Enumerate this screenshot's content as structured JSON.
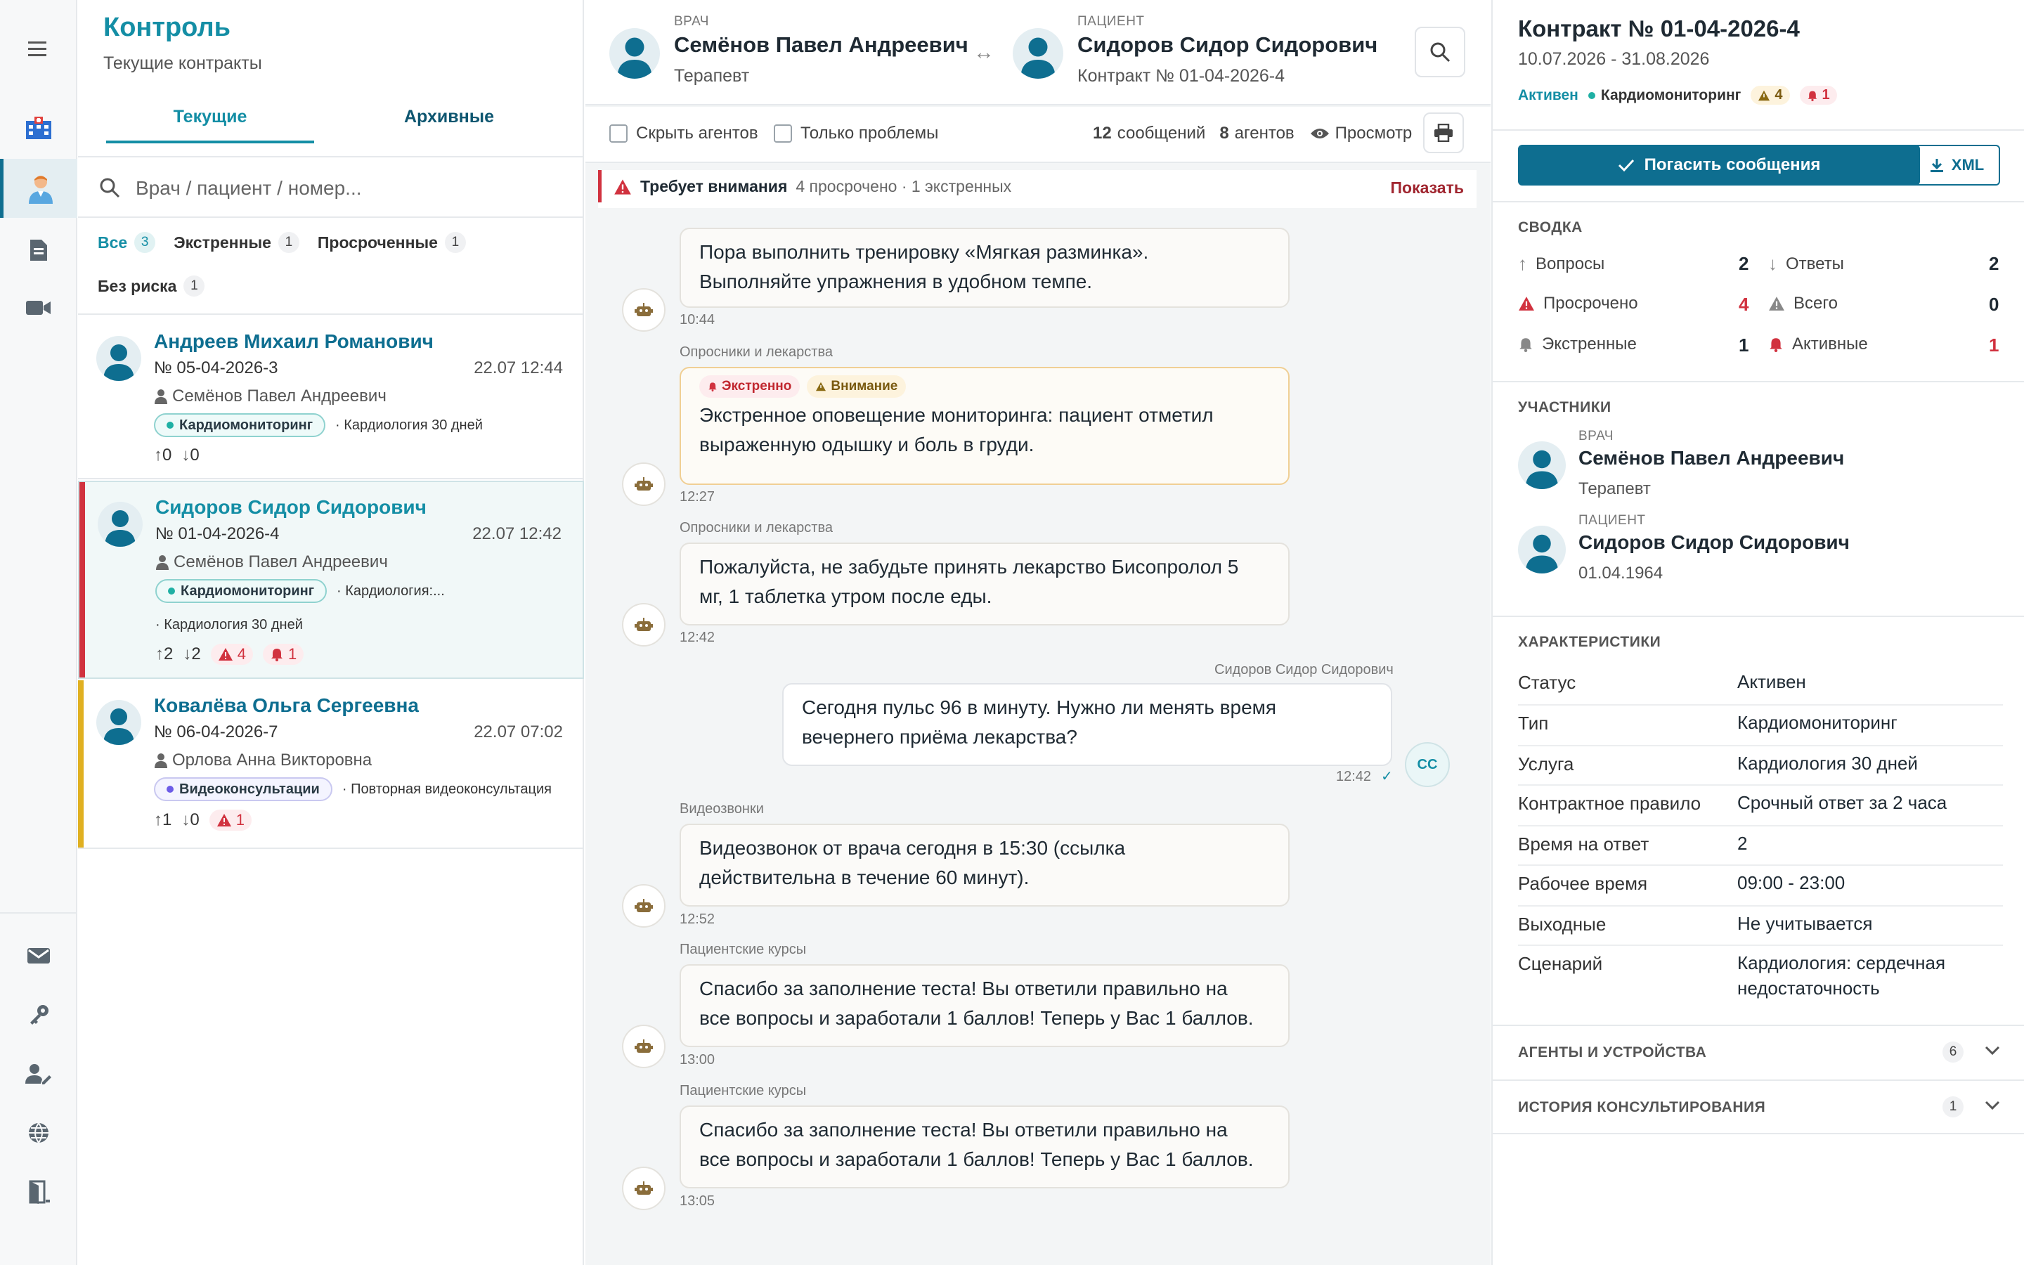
{
  "list": {
    "title": "Контроль",
    "subtitle": "Текущие контракты",
    "tabs": [
      "Текущие",
      "Архивные"
    ],
    "search_placeholder": "Врач / пациент / номер...",
    "filters": [
      {
        "label": "Все",
        "count": "3"
      },
      {
        "label": "Экстренные",
        "count": "1"
      },
      {
        "label": "Просроченные",
        "count": "1"
      },
      {
        "label": "Без риска",
        "count": "1"
      }
    ],
    "cards": [
      {
        "name": "Андреев Михаил Романович",
        "number": "№ 05-04-2026-3",
        "date": "22.07 12:44",
        "doctor": "Семёнов Павел Андреевич",
        "type": "Кардиомониторинг",
        "service": "Кардиология 30 дней",
        "up": "0",
        "down": "0"
      },
      {
        "name": "Сидоров Сидор Сидорович",
        "number": "№ 01-04-2026-4",
        "date": "22.07 12:42",
        "doctor": "Семёнов Павел Андреевич",
        "type": "Кардиомониторинг",
        "service": "Кардиология:...",
        "service2": "Кардиология 30 дней",
        "up": "2",
        "down": "2",
        "overdue": "4",
        "urgent": "1"
      },
      {
        "name": "Ковалёва Ольга Сергеевна",
        "number": "№ 06-04-2026-7",
        "date": "22.07 07:02",
        "doctor": "Орлова Анна Викторовна",
        "type": "Видеоконсультации",
        "service": "Повторная видеоконсультация",
        "up": "1",
        "down": "0",
        "overdue": "1"
      }
    ]
  },
  "chat": {
    "doctor_cap": "ВРАЧ",
    "doctor_name": "Семёнов Павел Андреевич",
    "doctor_role": "Терапевт",
    "patient_cap": "ПАЦИЕНТ",
    "patient_name": "Сидоров Сидор Сидорович",
    "patient_contract": "Контракт № 01-04-2026-4",
    "hide_agents": "Скрыть агентов",
    "only_problems": "Только проблемы",
    "messages_count": "12",
    "messages_label": "сообщений",
    "agents_count": "8",
    "agents_label": "агентов",
    "preview": "Просмотр",
    "alert_title": "Требует внимания",
    "alert_text": "4 просрочено · 1 экстренных",
    "alert_action": "Показать",
    "messages": [
      {
        "label": "",
        "text1": "Пора выполнить тренировку «Мягкая разминка».",
        "text2": "Выполняйте упражнения в удобном темпе.",
        "time": "10:44"
      },
      {
        "label": "Опросники и лекарства",
        "tag1": "Экстренно",
        "tag2": "Внимание",
        "text1": "Экстренное оповещение мониторинга: пациент отметил",
        "text2": "выраженную одышку и боль в груди.",
        "time": "12:27"
      },
      {
        "label": "Опросники и лекарства",
        "text1": "Пожалуйста, не забудьте принять лекарство Бисопролол 5",
        "text2": "мг, 1 таблетка утром после еды.",
        "time": "12:42"
      },
      {
        "label": "Сидоров Сидор Сидорович",
        "text1": "Сегодня пульс 96 в минуту. Нужно ли менять время",
        "text2": "вечернего приёма лекарства?",
        "time": "12:42",
        "initials": "СС"
      },
      {
        "label": "Видеозвонки",
        "text1": "Видеозвонок от врача сегодня в 15:30 (ссылка",
        "text2": "действительна в течение 60 минут).",
        "time": "12:52"
      },
      {
        "label": "Пациентские курсы",
        "text1": "Спасибо за заполнение теста! Вы ответили правильно на",
        "text2": "все вопросы и заработали 1 баллов! Теперь у Вас 1 баллов.",
        "time": "13:00"
      },
      {
        "label": "Пациентские курсы",
        "text1": "Спасибо за заполнение теста! Вы ответили правильно на",
        "text2": "все вопросы и заработали 1 баллов! Теперь у Вас 1 баллов.",
        "time": "13:05"
      }
    ]
  },
  "right": {
    "title": "Контракт № 01-04-2026-4",
    "period": "10.07.2026 - 31.08.2026",
    "status": "Активен",
    "type": "Кардиомониторинг",
    "badge_overdue": "4",
    "badge_urgent": "1",
    "repay_button": "Погасить сообщения",
    "xml_button": "XML",
    "summary_title": "СВОДКА",
    "summary": [
      {
        "label": "Вопросы",
        "value": "2"
      },
      {
        "label": "Ответы",
        "value": "2"
      },
      {
        "label": "Просрочено",
        "value": "4"
      },
      {
        "label": "Всего",
        "value": "0"
      },
      {
        "label": "Экстренные",
        "value": "1"
      },
      {
        "label": "Активные",
        "value": "1"
      }
    ],
    "participants_title": "УЧАСТНИКИ",
    "doctor_cap": "ВРАЧ",
    "doctor_name": "Семёнов Павел Андреевич",
    "doctor_role": "Терапевт",
    "patient_cap": "ПАЦИЕНТ",
    "patient_name": "Сидоров Сидор Сидорович",
    "patient_dob": "01.04.1964",
    "props_title": "ХАРАКТЕРИСТИКИ",
    "props": [
      {
        "k": "Статус",
        "v": "Активен"
      },
      {
        "k": "Тип",
        "v": "Кардиомониторинг"
      },
      {
        "k": "Услуга",
        "v": "Кардиология 30 дней"
      },
      {
        "k": "Контрактное правило",
        "v": "Срочный ответ за 2 часа"
      },
      {
        "k": "Время на ответ",
        "v": "2"
      },
      {
        "k": "Рабочее время",
        "v": "09:00 - 23:00"
      },
      {
        "k": "Выходные",
        "v": "Не учитывается"
      },
      {
        "k": "Сценарий",
        "v": "Кардиология: сердечная недостаточность"
      }
    ],
    "agents_title": "АГЕНТЫ И УСТРОЙСТВА",
    "agents_count": "6",
    "history_title": "ИСТОРИЯ КОНСУЛЬТИРОВАНИЯ",
    "history_count": "1"
  },
  "colors": {
    "accent": "#0e6e90",
    "teal": "#148ea5",
    "danger": "#d1323f",
    "warning": "#c98a10"
  }
}
